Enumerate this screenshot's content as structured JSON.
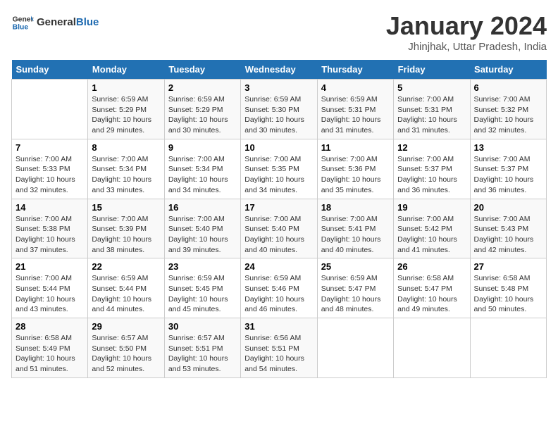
{
  "header": {
    "logo_general": "General",
    "logo_blue": "Blue",
    "title": "January 2024",
    "location": "Jhinjhak, Uttar Pradesh, India"
  },
  "days_of_week": [
    "Sunday",
    "Monday",
    "Tuesday",
    "Wednesday",
    "Thursday",
    "Friday",
    "Saturday"
  ],
  "weeks": [
    [
      {
        "day": "",
        "sunrise": "",
        "sunset": "",
        "daylight": ""
      },
      {
        "day": "1",
        "sunrise": "6:59 AM",
        "sunset": "5:29 PM",
        "daylight": "10 hours and 29 minutes."
      },
      {
        "day": "2",
        "sunrise": "6:59 AM",
        "sunset": "5:29 PM",
        "daylight": "10 hours and 30 minutes."
      },
      {
        "day": "3",
        "sunrise": "6:59 AM",
        "sunset": "5:30 PM",
        "daylight": "10 hours and 30 minutes."
      },
      {
        "day": "4",
        "sunrise": "6:59 AM",
        "sunset": "5:31 PM",
        "daylight": "10 hours and 31 minutes."
      },
      {
        "day": "5",
        "sunrise": "7:00 AM",
        "sunset": "5:31 PM",
        "daylight": "10 hours and 31 minutes."
      },
      {
        "day": "6",
        "sunrise": "7:00 AM",
        "sunset": "5:32 PM",
        "daylight": "10 hours and 32 minutes."
      }
    ],
    [
      {
        "day": "7",
        "sunrise": "7:00 AM",
        "sunset": "5:33 PM",
        "daylight": "10 hours and 32 minutes."
      },
      {
        "day": "8",
        "sunrise": "7:00 AM",
        "sunset": "5:34 PM",
        "daylight": "10 hours and 33 minutes."
      },
      {
        "day": "9",
        "sunrise": "7:00 AM",
        "sunset": "5:34 PM",
        "daylight": "10 hours and 34 minutes."
      },
      {
        "day": "10",
        "sunrise": "7:00 AM",
        "sunset": "5:35 PM",
        "daylight": "10 hours and 34 minutes."
      },
      {
        "day": "11",
        "sunrise": "7:00 AM",
        "sunset": "5:36 PM",
        "daylight": "10 hours and 35 minutes."
      },
      {
        "day": "12",
        "sunrise": "7:00 AM",
        "sunset": "5:37 PM",
        "daylight": "10 hours and 36 minutes."
      },
      {
        "day": "13",
        "sunrise": "7:00 AM",
        "sunset": "5:37 PM",
        "daylight": "10 hours and 36 minutes."
      }
    ],
    [
      {
        "day": "14",
        "sunrise": "7:00 AM",
        "sunset": "5:38 PM",
        "daylight": "10 hours and 37 minutes."
      },
      {
        "day": "15",
        "sunrise": "7:00 AM",
        "sunset": "5:39 PM",
        "daylight": "10 hours and 38 minutes."
      },
      {
        "day": "16",
        "sunrise": "7:00 AM",
        "sunset": "5:40 PM",
        "daylight": "10 hours and 39 minutes."
      },
      {
        "day": "17",
        "sunrise": "7:00 AM",
        "sunset": "5:40 PM",
        "daylight": "10 hours and 40 minutes."
      },
      {
        "day": "18",
        "sunrise": "7:00 AM",
        "sunset": "5:41 PM",
        "daylight": "10 hours and 40 minutes."
      },
      {
        "day": "19",
        "sunrise": "7:00 AM",
        "sunset": "5:42 PM",
        "daylight": "10 hours and 41 minutes."
      },
      {
        "day": "20",
        "sunrise": "7:00 AM",
        "sunset": "5:43 PM",
        "daylight": "10 hours and 42 minutes."
      }
    ],
    [
      {
        "day": "21",
        "sunrise": "7:00 AM",
        "sunset": "5:44 PM",
        "daylight": "10 hours and 43 minutes."
      },
      {
        "day": "22",
        "sunrise": "6:59 AM",
        "sunset": "5:44 PM",
        "daylight": "10 hours and 44 minutes."
      },
      {
        "day": "23",
        "sunrise": "6:59 AM",
        "sunset": "5:45 PM",
        "daylight": "10 hours and 45 minutes."
      },
      {
        "day": "24",
        "sunrise": "6:59 AM",
        "sunset": "5:46 PM",
        "daylight": "10 hours and 46 minutes."
      },
      {
        "day": "25",
        "sunrise": "6:59 AM",
        "sunset": "5:47 PM",
        "daylight": "10 hours and 48 minutes."
      },
      {
        "day": "26",
        "sunrise": "6:58 AM",
        "sunset": "5:47 PM",
        "daylight": "10 hours and 49 minutes."
      },
      {
        "day": "27",
        "sunrise": "6:58 AM",
        "sunset": "5:48 PM",
        "daylight": "10 hours and 50 minutes."
      }
    ],
    [
      {
        "day": "28",
        "sunrise": "6:58 AM",
        "sunset": "5:49 PM",
        "daylight": "10 hours and 51 minutes."
      },
      {
        "day": "29",
        "sunrise": "6:57 AM",
        "sunset": "5:50 PM",
        "daylight": "10 hours and 52 minutes."
      },
      {
        "day": "30",
        "sunrise": "6:57 AM",
        "sunset": "5:51 PM",
        "daylight": "10 hours and 53 minutes."
      },
      {
        "day": "31",
        "sunrise": "6:56 AM",
        "sunset": "5:51 PM",
        "daylight": "10 hours and 54 minutes."
      },
      {
        "day": "",
        "sunrise": "",
        "sunset": "",
        "daylight": ""
      },
      {
        "day": "",
        "sunrise": "",
        "sunset": "",
        "daylight": ""
      },
      {
        "day": "",
        "sunrise": "",
        "sunset": "",
        "daylight": ""
      }
    ]
  ]
}
